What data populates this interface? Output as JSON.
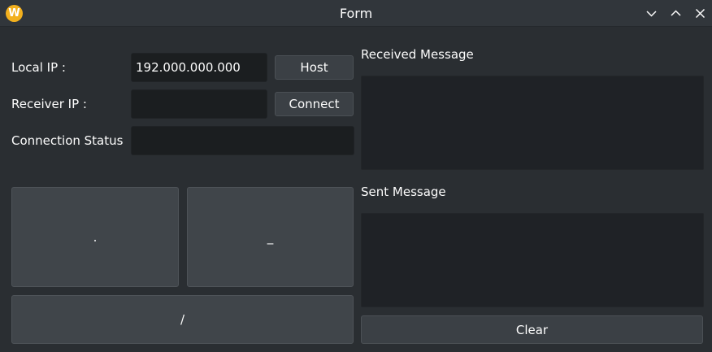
{
  "window": {
    "title": "Form",
    "app_icon_letter": "W",
    "controls": [
      "minimize-icon",
      "maximize-icon",
      "close-icon"
    ]
  },
  "form": {
    "local_ip_label": "Local IP :",
    "local_ip_value": "192.000.000.000",
    "receiver_ip_label": "Receiver IP :",
    "receiver_ip_value": "",
    "connection_status_label": "Connection Status",
    "connection_status_value": "",
    "host_button": "Host",
    "connect_button": "Connect"
  },
  "keys": {
    "dot": ".",
    "dash": "_",
    "slash": "/"
  },
  "messages": {
    "received_label": "Received Message",
    "received_value": "",
    "sent_label": "Sent Message",
    "sent_value": "",
    "clear_button": "Clear"
  },
  "colors": {
    "background": "#2a2e32",
    "field": "#1b1e20",
    "button": "#3b4045",
    "app_icon": "#f2b01e"
  }
}
